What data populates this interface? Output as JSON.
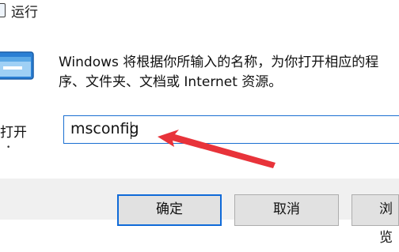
{
  "window": {
    "title": "运行",
    "icon": "run-app-icon"
  },
  "dialog": {
    "description": "Windows 将根据你所输入的名称，为你打开相应的程序、文件夹、文档或 Internet 资源。",
    "open_label": "打开",
    "input": {
      "value": "msconfig"
    }
  },
  "buttons": {
    "ok": "确定",
    "cancel": "取消",
    "browse": "浏览"
  },
  "colors": {
    "accent": "#0f6ad8",
    "arrow": "#e8333a",
    "footer": "#f0f0f0"
  }
}
